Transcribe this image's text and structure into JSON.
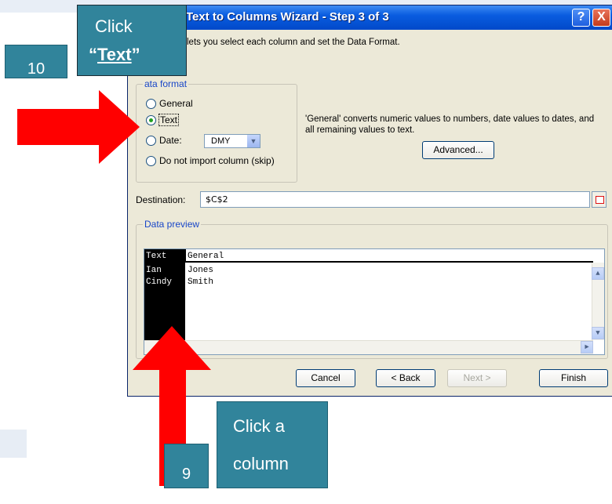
{
  "dialog": {
    "title": "Text to Columns Wizard - Step 3 of 3",
    "help_label": "?",
    "close_label": "X",
    "description": "lets you select each column and set the Data Format.",
    "format_group_label": "ata format",
    "formats": [
      {
        "label": "General",
        "checked": false
      },
      {
        "label": "Text",
        "checked": true
      },
      {
        "label": "Date:",
        "checked": false
      },
      {
        "label": "Do not import column (skip)",
        "checked": false
      }
    ],
    "date_value": "DMY",
    "info": "'General' converts numeric values to numbers, date values to dates, and all remaining values to text.",
    "advanced_label": "Advanced...",
    "destination_label": "Destination:",
    "destination_value": "$C$2",
    "preview_label": "Data preview",
    "preview": {
      "headers": [
        "Text",
        "General"
      ],
      "rows": [
        [
          "Ian",
          "Jones"
        ],
        [
          "Cindy",
          "Smith"
        ]
      ]
    },
    "buttons": {
      "cancel": "Cancel",
      "back": "< Back",
      "next": "Next >",
      "finish": "Finish"
    }
  },
  "callouts": {
    "step10": "10",
    "click_text_l1": "Click",
    "click_text_l2": "Text",
    "step9": "9",
    "click_column_l1": "Click a",
    "click_column_l2": "column"
  },
  "colors": {
    "callout": "#31849b",
    "arrow": "#ff0000",
    "titlebar": "#0a5ce0"
  }
}
